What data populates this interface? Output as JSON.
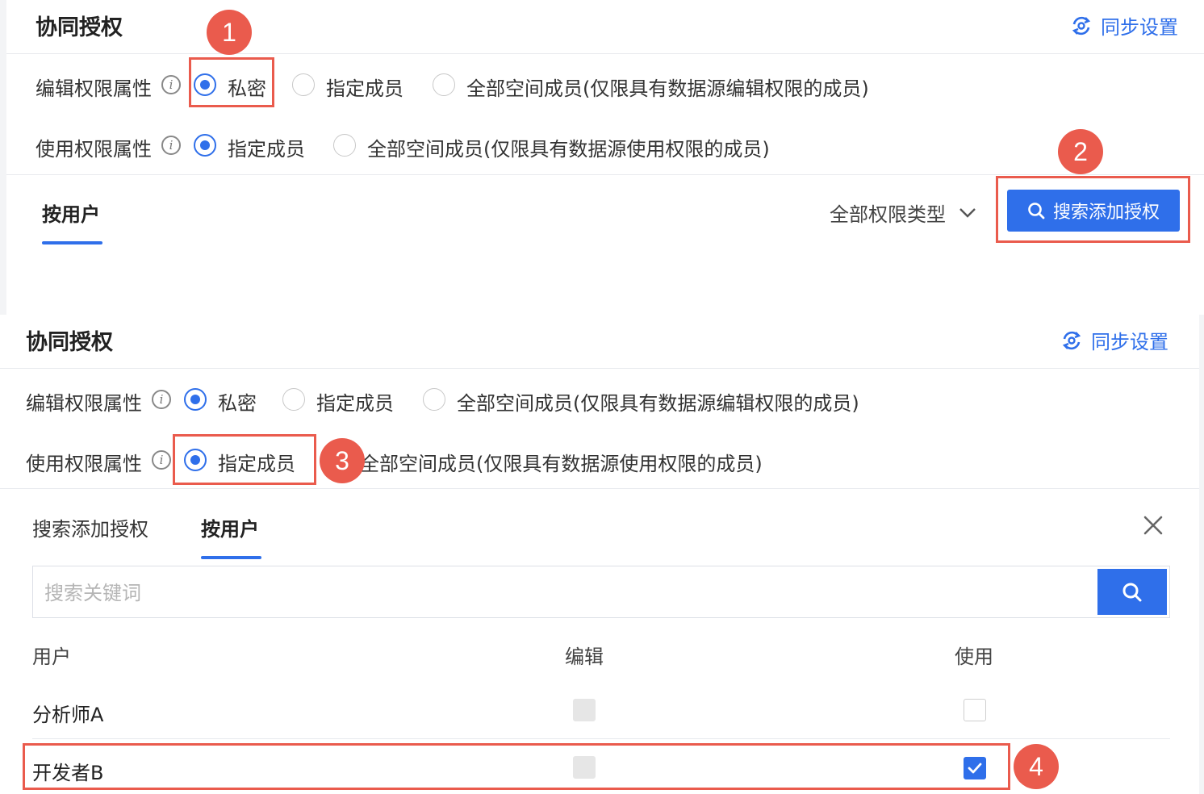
{
  "top_panel": {
    "title": "协同授权",
    "sync_settings_label": "同步设置",
    "edit_permission": {
      "label": "编辑权限属性",
      "info_icon": "i",
      "options": [
        "私密",
        "指定成员",
        "全部空间成员(仅限具有数据源编辑权限的成员)"
      ],
      "selected": "私密"
    },
    "use_permission": {
      "label": "使用权限属性",
      "info_icon": "i",
      "options": [
        "指定成员",
        "全部空间成员(仅限具有数据源使用权限的成员)"
      ],
      "selected": "指定成员"
    },
    "tab_by_user": "按用户",
    "permission_type_dropdown": "全部权限类型",
    "search_add_button": "搜索添加授权"
  },
  "bottom_panel": {
    "title": "协同授权",
    "sync_settings_label": "同步设置",
    "edit_permission": {
      "label": "编辑权限属性",
      "info_icon": "i",
      "options": [
        "私密",
        "指定成员",
        "全部空间成员(仅限具有数据源编辑权限的成员)"
      ],
      "selected": "私密"
    },
    "use_permission": {
      "label": "使用权限属性",
      "info_icon": "i",
      "options": [
        "指定成员",
        "全部空间成员(仅限具有数据源使用权限的成员)"
      ],
      "selected": "指定成员"
    },
    "tabs": [
      "搜索添加授权",
      "按用户"
    ],
    "active_tab": "按用户",
    "search": {
      "placeholder": "搜索关键词",
      "value": ""
    },
    "table": {
      "headers": [
        "用户",
        "编辑",
        "使用"
      ],
      "rows": [
        {
          "user": "分析师A",
          "edit": "disabled",
          "use": "unchecked"
        },
        {
          "user": "开发者B",
          "edit": "disabled",
          "use": "checked"
        }
      ]
    }
  },
  "annotations": [
    "1",
    "2",
    "3",
    "4"
  ],
  "colors": {
    "accent": "#2f6fea",
    "highlight": "#ea5b4d",
    "divider": "#e8eaee"
  },
  "icons": [
    "sync-icon",
    "info-icon",
    "chevron-down-icon",
    "search-icon",
    "close-icon",
    "checkmark-icon"
  ]
}
